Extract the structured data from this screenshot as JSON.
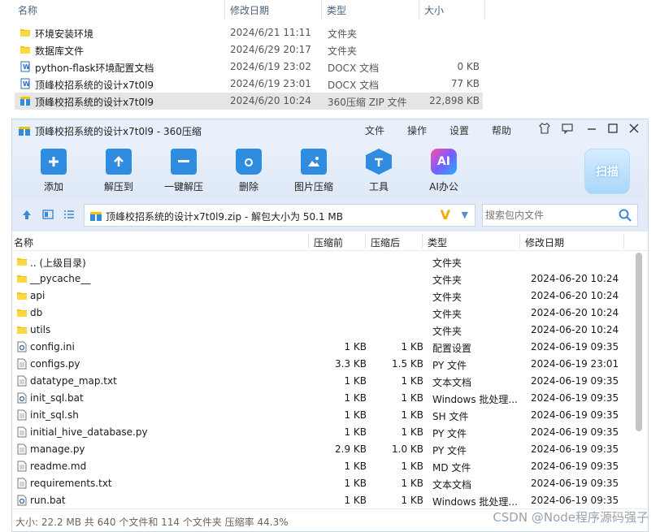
{
  "explorer": {
    "headers": {
      "name": "名称",
      "date": "修改日期",
      "type": "类型",
      "size": "大小"
    },
    "rows": [
      {
        "icon": "folder-icon",
        "name": "环境安装环境",
        "date": "2024/6/21 11:11",
        "type": "文件夹",
        "size": ""
      },
      {
        "icon": "folder-icon",
        "name": "数据库文件",
        "date": "2024/6/29 20:17",
        "type": "文件夹",
        "size": ""
      },
      {
        "icon": "word-doc-icon",
        "name": "python-flask环境配置文档",
        "date": "2024/6/19 23:02",
        "type": "DOCX 文档",
        "size": "0 KB"
      },
      {
        "icon": "word-doc-icon",
        "name": "顶峰校招系统的设计x7t0l9",
        "date": "2024/6/19 23:01",
        "type": "DOCX 文档",
        "size": "77 KB"
      },
      {
        "icon": "zip-archive-icon",
        "name": "顶峰校招系统的设计x7t0l9",
        "date": "2024/6/20 10:24",
        "type": "360压缩 ZIP 文件",
        "size": "22,898 KB"
      }
    ]
  },
  "window": {
    "title": "顶峰校招系统的设计x7t0l9 - 360压缩",
    "menu": [
      "文件",
      "操作",
      "设置",
      "帮助"
    ],
    "toolbar": [
      {
        "name": "add",
        "label": "添加",
        "icon": "add-file-icon"
      },
      {
        "name": "extract-to",
        "label": "解压到",
        "icon": "extract-to-icon"
      },
      {
        "name": "one-click-extract",
        "label": "一键解压",
        "icon": "one-click-extract-icon"
      },
      {
        "name": "delete",
        "label": "删除",
        "icon": "trash-icon"
      },
      {
        "name": "image-compress",
        "label": "图片压缩",
        "icon": "image-compress-icon"
      },
      {
        "name": "tools",
        "label": "工具",
        "icon": "tools-icon"
      },
      {
        "name": "ai-office",
        "label": "AI办公",
        "icon": "ai-icon",
        "icon_text": "AI"
      }
    ],
    "scan_label": "扫描",
    "path_text": "顶峰校招系统的设计x7t0l9.zip - 解包大小为 50.1 MB",
    "search_placeholder": "搜索包内文件",
    "columns": {
      "name": "名称",
      "before": "压缩前",
      "after": "压缩后",
      "type": "类型",
      "date": "修改日期"
    },
    "files": [
      {
        "icon": "folder-icon",
        "name": ".. (上级目录)",
        "before": "",
        "after": "",
        "type": "文件夹",
        "date": ""
      },
      {
        "icon": "folder-icon",
        "name": "__pycache__",
        "before": "",
        "after": "",
        "type": "文件夹",
        "date": "2024-06-20 10:24"
      },
      {
        "icon": "folder-icon",
        "name": "api",
        "before": "",
        "after": "",
        "type": "文件夹",
        "date": "2024-06-20 10:24"
      },
      {
        "icon": "folder-icon",
        "name": "db",
        "before": "",
        "after": "",
        "type": "文件夹",
        "date": "2024-06-20 10:24"
      },
      {
        "icon": "folder-icon",
        "name": "utils",
        "before": "",
        "after": "",
        "type": "文件夹",
        "date": "2024-06-20 10:24"
      },
      {
        "icon": "settings-file-icon",
        "name": "config.ini",
        "before": "1 KB",
        "after": "1 KB",
        "type": "配置设置",
        "date": "2024-06-19 09:35"
      },
      {
        "icon": "text-file-icon",
        "name": "configs.py",
        "before": "3.3 KB",
        "after": "1.5 KB",
        "type": "PY 文件",
        "date": "2024-06-19 23:01"
      },
      {
        "icon": "text-file-icon",
        "name": "datatype_map.txt",
        "before": "1 KB",
        "after": "1 KB",
        "type": "文本文档",
        "date": "2024-06-19 09:35"
      },
      {
        "icon": "settings-file-icon",
        "name": "init_sql.bat",
        "before": "1 KB",
        "after": "1 KB",
        "type": "Windows 批处理...",
        "date": "2024-06-19 09:35"
      },
      {
        "icon": "text-file-icon",
        "name": "init_sql.sh",
        "before": "1 KB",
        "after": "1 KB",
        "type": "SH 文件",
        "date": "2024-06-19 09:35"
      },
      {
        "icon": "text-file-icon",
        "name": "initial_hive_database.py",
        "before": "1 KB",
        "after": "1 KB",
        "type": "PY 文件",
        "date": "2024-06-19 09:35"
      },
      {
        "icon": "text-file-icon",
        "name": "manage.py",
        "before": "2.9 KB",
        "after": "1.0 KB",
        "type": "PY 文件",
        "date": "2024-06-19 09:35"
      },
      {
        "icon": "text-file-icon",
        "name": "readme.md",
        "before": "1 KB",
        "after": "1 KB",
        "type": "MD 文件",
        "date": "2024-06-19 09:35"
      },
      {
        "icon": "text-file-icon",
        "name": "requirements.txt",
        "before": "1 KB",
        "after": "1 KB",
        "type": "文本文档",
        "date": "2024-06-19 09:35"
      },
      {
        "icon": "settings-file-icon",
        "name": "run.bat",
        "before": "1 KB",
        "after": "1 KB",
        "type": "Windows 批处理...",
        "date": "2024-06-19 09:35"
      }
    ],
    "status": "大小: 22.2 MB 共 640 个文件和 114 个文件夹 压缩率 44.3%"
  },
  "watermark": "CSDN @Node程序源码强子",
  "colors": {
    "accent": "#2f8ce0",
    "folder": "#f5c400",
    "titlebar": "#e8f0fb"
  }
}
